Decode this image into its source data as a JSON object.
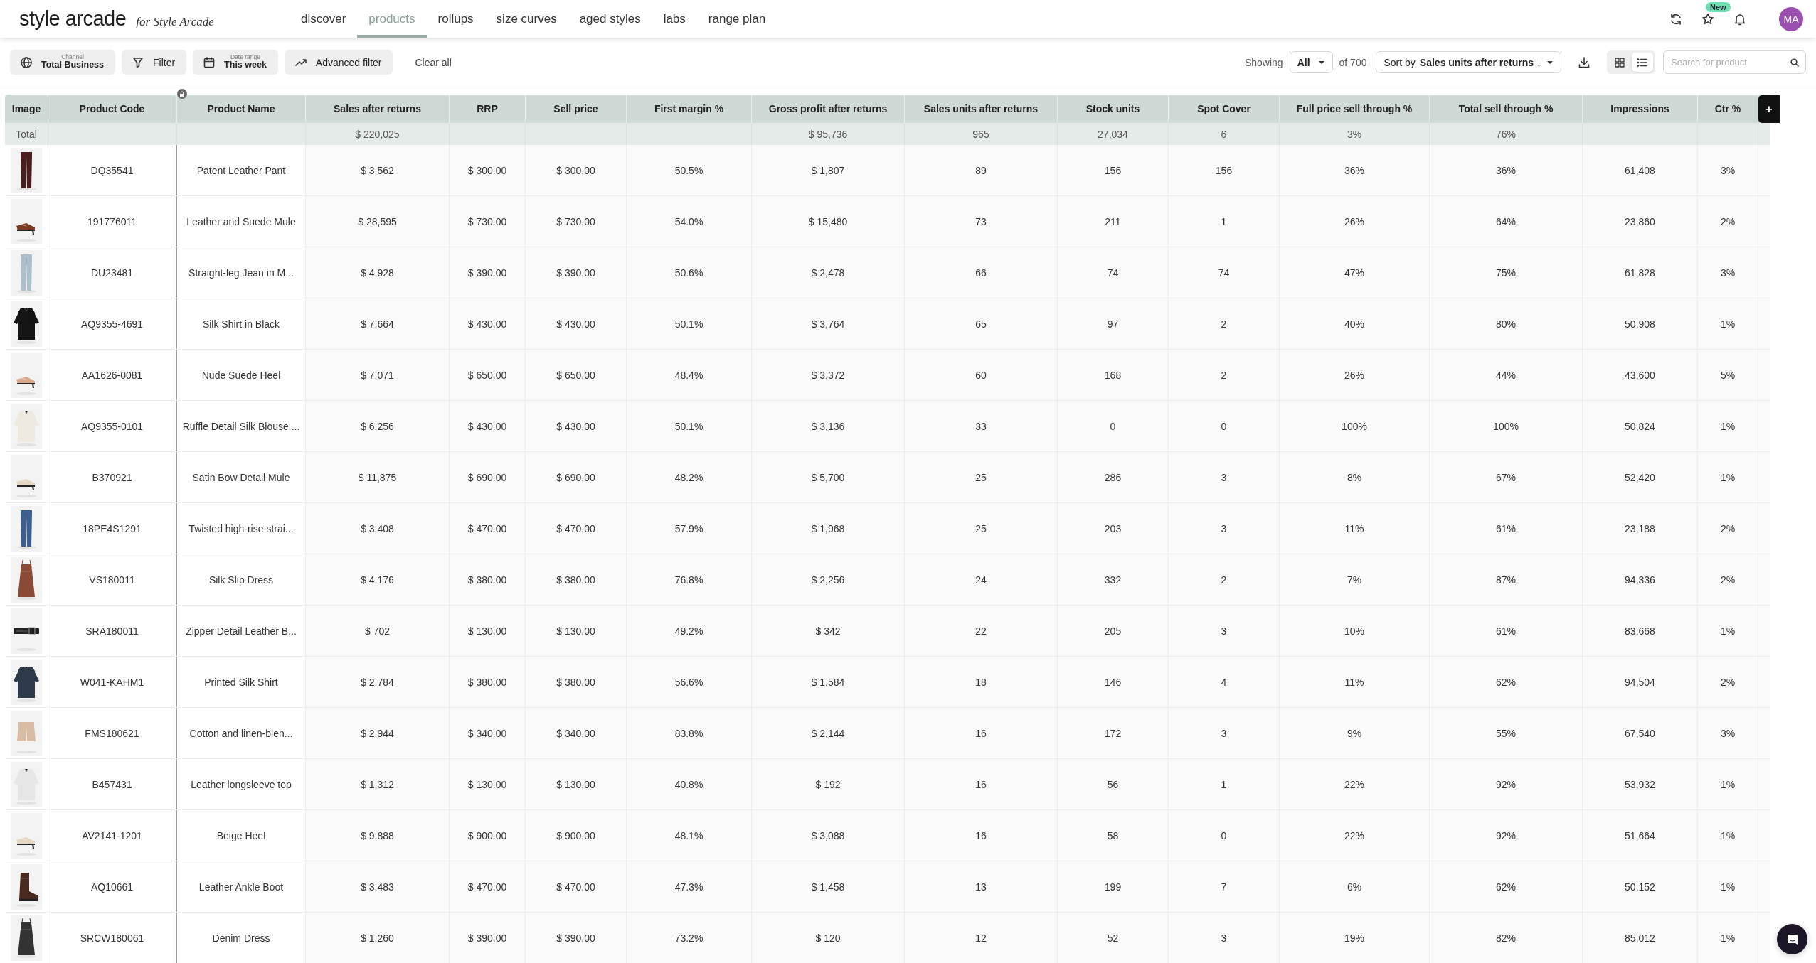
{
  "nav": {
    "logo": "style arcade",
    "tagline": "for Style Arcade",
    "tabs": [
      {
        "label": "discover",
        "selected": false
      },
      {
        "label": "products",
        "selected": true
      },
      {
        "label": "rollups",
        "selected": false
      },
      {
        "label": "size curves",
        "selected": false
      },
      {
        "label": "aged styles",
        "selected": false
      },
      {
        "label": "labs",
        "selected": false
      },
      {
        "label": "range plan",
        "selected": false
      }
    ],
    "badge": "New",
    "avatar": "MA"
  },
  "toolbar": {
    "filters": [
      {
        "kind": "channel",
        "caption": "Channel",
        "value": "Total Business"
      },
      {
        "kind": "filter",
        "value": "Filter"
      },
      {
        "kind": "date",
        "caption": "Date range",
        "value": "This week"
      },
      {
        "kind": "advanced",
        "value": "Advanced filter"
      }
    ],
    "clear": "Clear all",
    "showing_label": "Showing",
    "showing_value": "All",
    "of_total": "of 700",
    "sort_label": "Sort by",
    "sort_value": "Sales units after returns ↓",
    "views": [
      {
        "kind": "grid",
        "selected": false
      },
      {
        "kind": "list",
        "selected": true
      }
    ],
    "search": {
      "placeholder": "Search for product"
    }
  },
  "table": {
    "add_column": "+",
    "image_column": {
      "label": "Image",
      "total": "Total"
    },
    "columns": [
      {
        "label": "Product Code"
      },
      {
        "label": "Product Name"
      },
      {
        "label": "Sales after returns",
        "total": "$ 220,025"
      },
      {
        "label": "RRP"
      },
      {
        "label": "Sell price"
      },
      {
        "label": "First margin %"
      },
      {
        "label": "Gross profit after returns",
        "total": "$ 95,736"
      },
      {
        "label": "Sales units after returns",
        "total": "965"
      },
      {
        "label": "Stock units",
        "total": "27,034"
      },
      {
        "label": "Spot Cover",
        "total": "6"
      },
      {
        "label": "Full price sell through %",
        "total": "3%"
      },
      {
        "label": "Total sell through %",
        "total": "76%"
      },
      {
        "label": "Impressions"
      },
      {
        "label": "Ctr %"
      }
    ],
    "rows": [
      {
        "cells": [
          "DQ35541",
          "Patent Leather Pant",
          "$ 3,562",
          "$ 300.00",
          "$ 300.00",
          "50.5%",
          "$ 1,807",
          "89",
          "156",
          "156",
          "36%",
          "36%",
          "61,408",
          "3%"
        ]
      },
      {
        "cells": [
          "191776011",
          "Leather and Suede Mule",
          "$ 28,595",
          "$ 730.00",
          "$ 730.00",
          "54.0%",
          "$ 15,480",
          "73",
          "211",
          "1",
          "26%",
          "64%",
          "23,860",
          "2%"
        ]
      },
      {
        "cells": [
          "DU23481",
          "Straight-leg Jean in M...",
          "$ 4,928",
          "$ 390.00",
          "$ 390.00",
          "50.6%",
          "$ 2,478",
          "66",
          "74",
          "74",
          "47%",
          "75%",
          "61,828",
          "3%"
        ]
      },
      {
        "cells": [
          "AQ9355-4691",
          "Silk Shirt in Black",
          "$ 7,664",
          "$ 430.00",
          "$ 430.00",
          "50.1%",
          "$ 3,764",
          "65",
          "97",
          "2",
          "40%",
          "80%",
          "50,908",
          "1%"
        ]
      },
      {
        "cells": [
          "AA1626-0081",
          "Nude Suede Heel",
          "$ 7,071",
          "$ 650.00",
          "$ 650.00",
          "48.4%",
          "$ 3,372",
          "60",
          "168",
          "2",
          "26%",
          "44%",
          "43,600",
          "5%"
        ]
      },
      {
        "cells": [
          "AQ9355-0101",
          "Ruffle Detail Silk Blouse ...",
          "$ 6,256",
          "$ 430.00",
          "$ 430.00",
          "50.1%",
          "$ 3,136",
          "33",
          "0",
          "0",
          "100%",
          "100%",
          "50,824",
          "1%"
        ]
      },
      {
        "cells": [
          "B370921",
          "Satin Bow Detail Mule",
          "$ 11,875",
          "$ 690.00",
          "$ 690.00",
          "48.2%",
          "$ 5,700",
          "25",
          "286",
          "3",
          "8%",
          "67%",
          "52,420",
          "1%"
        ]
      },
      {
        "cells": [
          "18PE4S1291",
          "Twisted high-rise strai...",
          "$ 3,408",
          "$ 470.00",
          "$ 470.00",
          "57.9%",
          "$ 1,968",
          "25",
          "203",
          "3",
          "11%",
          "61%",
          "23,188",
          "2%"
        ]
      },
      {
        "cells": [
          "VS180011",
          "Silk Slip Dress",
          "$ 4,176",
          "$ 380.00",
          "$ 380.00",
          "76.8%",
          "$ 2,256",
          "24",
          "332",
          "2",
          "7%",
          "87%",
          "94,336",
          "2%"
        ]
      },
      {
        "cells": [
          "SRA180011",
          "Zipper Detail Leather B...",
          "$ 702",
          "$ 130.00",
          "$ 130.00",
          "49.2%",
          "$ 342",
          "22",
          "205",
          "3",
          "10%",
          "61%",
          "83,668",
          "1%"
        ]
      },
      {
        "cells": [
          "W041-KAHM1",
          "Printed Silk Shirt",
          "$ 2,784",
          "$ 380.00",
          "$ 380.00",
          "56.6%",
          "$ 1,584",
          "18",
          "146",
          "4",
          "11%",
          "62%",
          "94,504",
          "2%"
        ]
      },
      {
        "cells": [
          "FMS180621",
          "Cotton and linen-blen...",
          "$ 2,944",
          "$ 340.00",
          "$ 340.00",
          "83.8%",
          "$ 2,144",
          "16",
          "172",
          "3",
          "9%",
          "55%",
          "67,540",
          "3%"
        ]
      },
      {
        "cells": [
          "B457431",
          "Leather longsleeve top",
          "$ 1,312",
          "$ 130.00",
          "$ 130.00",
          "40.8%",
          "$ 192",
          "16",
          "56",
          "1",
          "22%",
          "92%",
          "53,932",
          "1%"
        ]
      },
      {
        "cells": [
          "AV2141-1201",
          "Beige Heel",
          "$ 9,888",
          "$ 900.00",
          "$ 900.00",
          "48.1%",
          "$ 3,088",
          "16",
          "58",
          "0",
          "22%",
          "92%",
          "51,664",
          "1%"
        ]
      },
      {
        "cells": [
          "AQ10661",
          "Leather Ankle Boot",
          "$ 3,483",
          "$ 470.00",
          "$ 470.00",
          "47.3%",
          "$ 1,458",
          "13",
          "199",
          "7",
          "6%",
          "62%",
          "50,152",
          "1%"
        ]
      },
      {
        "cells": [
          "SRCW180061",
          "Denim Dress",
          "$ 1,260",
          "$ 390.00",
          "$ 390.00",
          "73.2%",
          "$ 120",
          "12",
          "52",
          "3",
          "19%",
          "82%",
          "85,012",
          "1%"
        ]
      }
    ]
  }
}
